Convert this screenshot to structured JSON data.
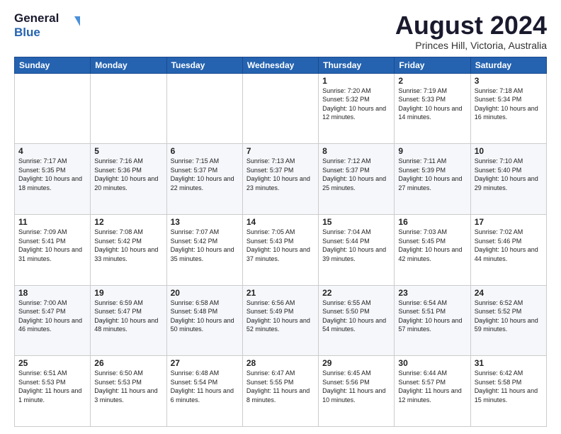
{
  "logo": {
    "line1": "General",
    "line2": "Blue"
  },
  "header": {
    "title": "August 2024",
    "subtitle": "Princes Hill, Victoria, Australia"
  },
  "days_of_week": [
    "Sunday",
    "Monday",
    "Tuesday",
    "Wednesday",
    "Thursday",
    "Friday",
    "Saturday"
  ],
  "weeks": [
    [
      {
        "day": "",
        "info": ""
      },
      {
        "day": "",
        "info": ""
      },
      {
        "day": "",
        "info": ""
      },
      {
        "day": "",
        "info": ""
      },
      {
        "day": "1",
        "info": "Sunrise: 7:20 AM\nSunset: 5:32 PM\nDaylight: 10 hours\nand 12 minutes."
      },
      {
        "day": "2",
        "info": "Sunrise: 7:19 AM\nSunset: 5:33 PM\nDaylight: 10 hours\nand 14 minutes."
      },
      {
        "day": "3",
        "info": "Sunrise: 7:18 AM\nSunset: 5:34 PM\nDaylight: 10 hours\nand 16 minutes."
      }
    ],
    [
      {
        "day": "4",
        "info": "Sunrise: 7:17 AM\nSunset: 5:35 PM\nDaylight: 10 hours\nand 18 minutes."
      },
      {
        "day": "5",
        "info": "Sunrise: 7:16 AM\nSunset: 5:36 PM\nDaylight: 10 hours\nand 20 minutes."
      },
      {
        "day": "6",
        "info": "Sunrise: 7:15 AM\nSunset: 5:37 PM\nDaylight: 10 hours\nand 22 minutes."
      },
      {
        "day": "7",
        "info": "Sunrise: 7:13 AM\nSunset: 5:37 PM\nDaylight: 10 hours\nand 23 minutes."
      },
      {
        "day": "8",
        "info": "Sunrise: 7:12 AM\nSunset: 5:37 PM\nDaylight: 10 hours\nand 25 minutes."
      },
      {
        "day": "9",
        "info": "Sunrise: 7:11 AM\nSunset: 5:39 PM\nDaylight: 10 hours\nand 27 minutes."
      },
      {
        "day": "10",
        "info": "Sunrise: 7:10 AM\nSunset: 5:40 PM\nDaylight: 10 hours\nand 29 minutes."
      }
    ],
    [
      {
        "day": "11",
        "info": "Sunrise: 7:09 AM\nSunset: 5:41 PM\nDaylight: 10 hours\nand 31 minutes."
      },
      {
        "day": "12",
        "info": "Sunrise: 7:08 AM\nSunset: 5:42 PM\nDaylight: 10 hours\nand 33 minutes."
      },
      {
        "day": "13",
        "info": "Sunrise: 7:07 AM\nSunset: 5:42 PM\nDaylight: 10 hours\nand 35 minutes."
      },
      {
        "day": "14",
        "info": "Sunrise: 7:05 AM\nSunset: 5:43 PM\nDaylight: 10 hours\nand 37 minutes."
      },
      {
        "day": "15",
        "info": "Sunrise: 7:04 AM\nSunset: 5:44 PM\nDaylight: 10 hours\nand 39 minutes."
      },
      {
        "day": "16",
        "info": "Sunrise: 7:03 AM\nSunset: 5:45 PM\nDaylight: 10 hours\nand 42 minutes."
      },
      {
        "day": "17",
        "info": "Sunrise: 7:02 AM\nSunset: 5:46 PM\nDaylight: 10 hours\nand 44 minutes."
      }
    ],
    [
      {
        "day": "18",
        "info": "Sunrise: 7:00 AM\nSunset: 5:47 PM\nDaylight: 10 hours\nand 46 minutes."
      },
      {
        "day": "19",
        "info": "Sunrise: 6:59 AM\nSunset: 5:47 PM\nDaylight: 10 hours\nand 48 minutes."
      },
      {
        "day": "20",
        "info": "Sunrise: 6:58 AM\nSunset: 5:48 PM\nDaylight: 10 hours\nand 50 minutes."
      },
      {
        "day": "21",
        "info": "Sunrise: 6:56 AM\nSunset: 5:49 PM\nDaylight: 10 hours\nand 52 minutes."
      },
      {
        "day": "22",
        "info": "Sunrise: 6:55 AM\nSunset: 5:50 PM\nDaylight: 10 hours\nand 54 minutes."
      },
      {
        "day": "23",
        "info": "Sunrise: 6:54 AM\nSunset: 5:51 PM\nDaylight: 10 hours\nand 57 minutes."
      },
      {
        "day": "24",
        "info": "Sunrise: 6:52 AM\nSunset: 5:52 PM\nDaylight: 10 hours\nand 59 minutes."
      }
    ],
    [
      {
        "day": "25",
        "info": "Sunrise: 6:51 AM\nSunset: 5:53 PM\nDaylight: 11 hours\nand 1 minute."
      },
      {
        "day": "26",
        "info": "Sunrise: 6:50 AM\nSunset: 5:53 PM\nDaylight: 11 hours\nand 3 minutes."
      },
      {
        "day": "27",
        "info": "Sunrise: 6:48 AM\nSunset: 5:54 PM\nDaylight: 11 hours\nand 6 minutes."
      },
      {
        "day": "28",
        "info": "Sunrise: 6:47 AM\nSunset: 5:55 PM\nDaylight: 11 hours\nand 8 minutes."
      },
      {
        "day": "29",
        "info": "Sunrise: 6:45 AM\nSunset: 5:56 PM\nDaylight: 11 hours\nand 10 minutes."
      },
      {
        "day": "30",
        "info": "Sunrise: 6:44 AM\nSunset: 5:57 PM\nDaylight: 11 hours\nand 12 minutes."
      },
      {
        "day": "31",
        "info": "Sunrise: 6:42 AM\nSunset: 5:58 PM\nDaylight: 11 hours\nand 15 minutes."
      }
    ]
  ]
}
